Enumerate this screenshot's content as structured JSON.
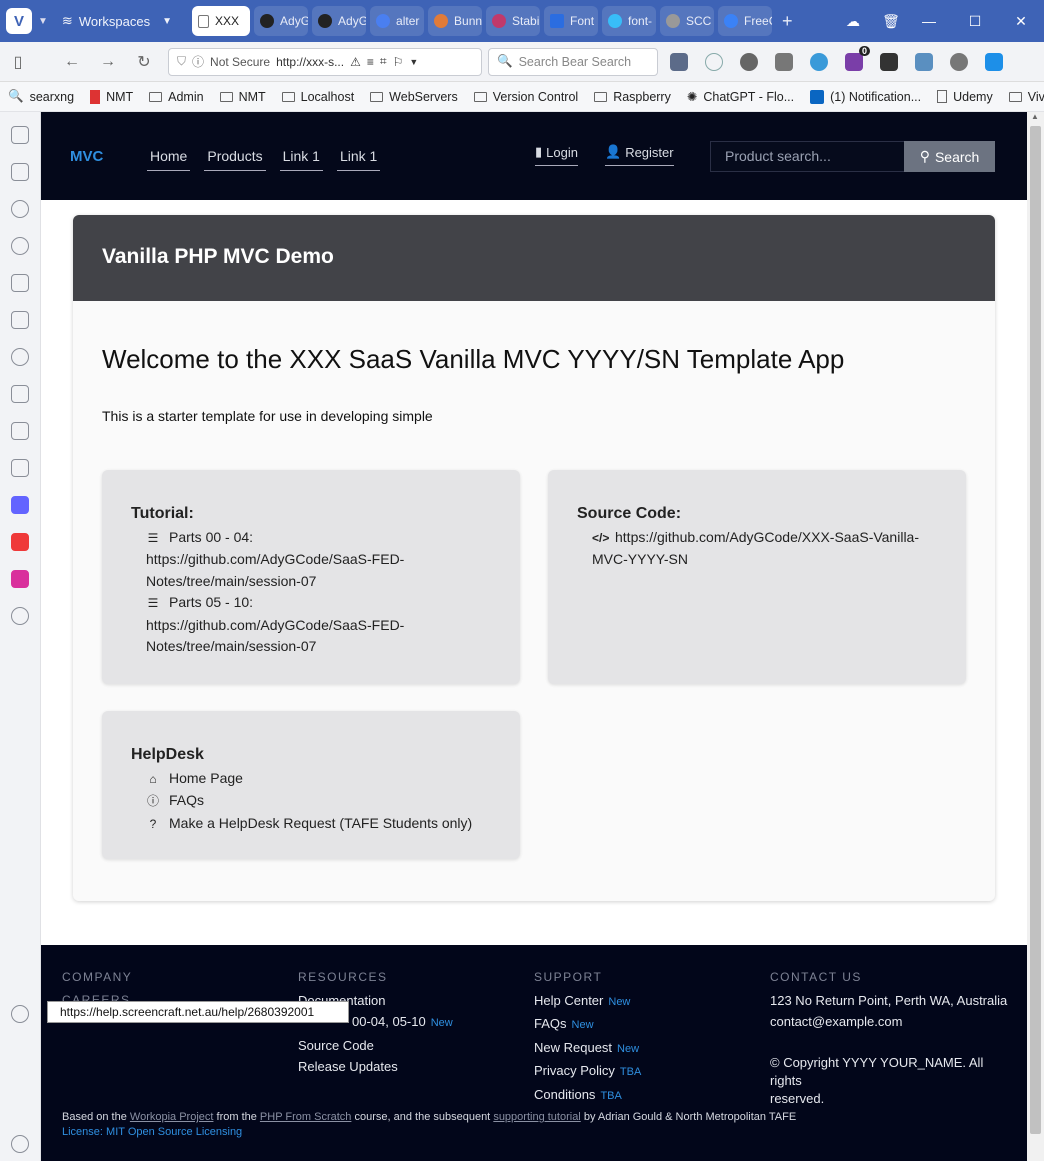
{
  "browser": {
    "workspaces_label": "Workspaces",
    "tabs": [
      {
        "label": "XXX",
        "active": true
      },
      {
        "label": "AdyG"
      },
      {
        "label": "AdyG"
      },
      {
        "label": "alter"
      },
      {
        "label": "Bunn"
      },
      {
        "label": "Stabi"
      },
      {
        "label": "Font"
      },
      {
        "label": "font-"
      },
      {
        "label": "SCC"
      },
      {
        "label": "FreeC"
      }
    ],
    "address": {
      "security": "Not Secure",
      "url": "http://xxx-s..."
    },
    "search_placeholder": "Search Bear Search",
    "extension_badge": "0",
    "bookmarks": [
      "searxng",
      "NMT",
      "Admin",
      "NMT",
      "Localhost",
      "WebServers",
      "Version Control",
      "Raspberry",
      "ChatGPT - Flo...",
      "(1) Notification...",
      "Udemy",
      "Vivaldi"
    ],
    "status_tooltip": "https://help.screencraft.net.au/help/2680392001"
  },
  "site": {
    "brand": "MVC",
    "nav": [
      "Home",
      "Products",
      "Link 1",
      "Link 1"
    ],
    "login": "Login",
    "register": "Register",
    "search_placeholder": "Product search...",
    "search_button": "Search"
  },
  "card": {
    "title": "Vanilla PHP MVC Demo",
    "welcome": "Welcome to the XXX SaaS Vanilla MVC YYYY/SN Template App",
    "intro": "This is a starter template for use in developing simple"
  },
  "tutorial": {
    "heading": "Tutorial:",
    "items": [
      {
        "line1": "Parts 00 - 04:",
        "line2": "https://github.com/AdyGCode/SaaS-FED-",
        "line3": "Notes/tree/main/session-07"
      },
      {
        "line1": "Parts 05 - 10:",
        "line2": "https://github.com/AdyGCode/SaaS-FED-",
        "line3": "Notes/tree/main/session-07"
      }
    ]
  },
  "source": {
    "heading": "Source Code:",
    "line1": "https://github.com/AdyGCode/XXX-SaaS-Vanilla-",
    "line2": "MVC-YYYY-SN"
  },
  "helpdesk": {
    "heading": "HelpDesk",
    "items": [
      "Home Page",
      "FAQs",
      "Make a HelpDesk Request (TAFE Students only)"
    ]
  },
  "footer": {
    "company": {
      "heading": "COMPANY",
      "items": [
        "CAREERS"
      ]
    },
    "resources": {
      "heading": "RESOURCES",
      "items": [
        "Documentation",
        "00-04, 05-10",
        "Source Code",
        "Release Updates"
      ],
      "new_label": "New"
    },
    "support": {
      "heading": "SUPPORT",
      "items": [
        {
          "label": "Help Center",
          "tag": "New"
        },
        {
          "label": "FAQs",
          "tag": "New"
        },
        {
          "label": "New Request",
          "tag": "New"
        },
        {
          "label": "Privacy Policy",
          "tag": "TBA"
        },
        {
          "label": "Conditions",
          "tag": "TBA"
        }
      ]
    },
    "contact": {
      "heading": "CONTACT US",
      "address": "123 No Return Point, Perth WA, Australia",
      "email": "contact@example.com",
      "copyright1": "© Copyright YYYY YOUR_NAME. All rights",
      "copyright2": "reserved."
    },
    "credits": {
      "t1": "Based on the ",
      "l1": "Workopia Project",
      "t2": " from the ",
      "l2": "PHP From Scratch",
      "t3": " course, and the subsequent ",
      "l3": "supporting tutorial",
      "t4": " by Adrian Gould & North Metropolitan TAFE",
      "license": "License: MIT Open Source Licensing"
    }
  }
}
